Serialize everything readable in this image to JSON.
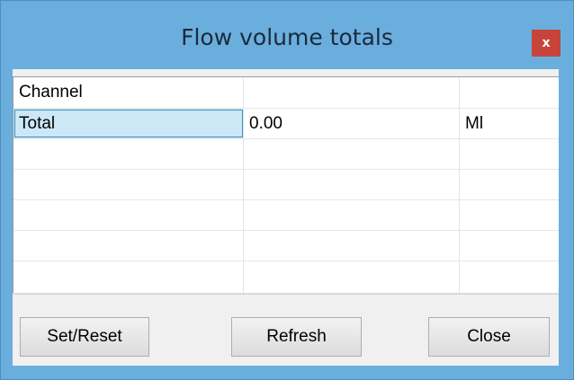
{
  "window": {
    "title": "Flow volume totals",
    "close_glyph": "x",
    "close_icon": "close-icon"
  },
  "table": {
    "header": [
      "Channel",
      "",
      ""
    ],
    "rows": [
      [
        "Total",
        "0.00",
        "Ml"
      ],
      [
        "",
        "",
        ""
      ],
      [
        "",
        "",
        ""
      ],
      [
        "",
        "",
        ""
      ],
      [
        "",
        "",
        ""
      ]
    ],
    "selected_row": 0
  },
  "buttons": {
    "set_reset": "Set/Reset",
    "refresh": "Refresh",
    "close": "Close"
  },
  "colors": {
    "titlebar": "#6aaede",
    "close_button": "#c7443a",
    "selection": "#cce8f6"
  }
}
